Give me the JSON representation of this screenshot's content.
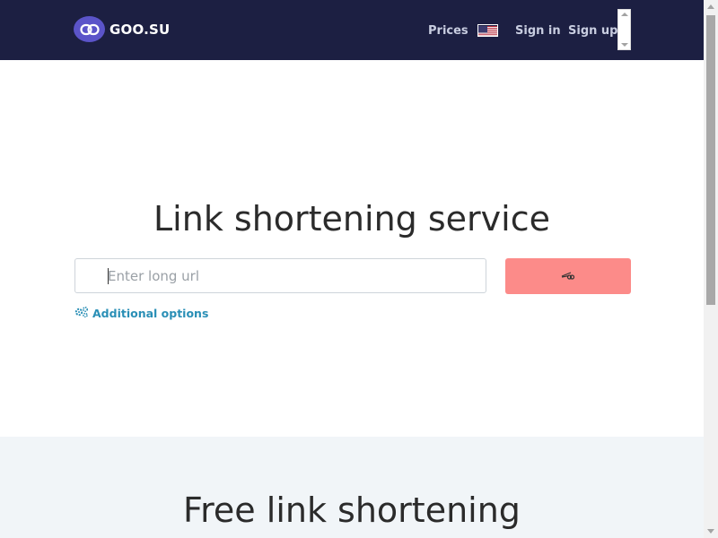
{
  "brand": {
    "name": "GOO.SU",
    "logo_color": "#5b54c9"
  },
  "nav": {
    "prices": "Prices",
    "language_flag": "us-flag-icon",
    "sign_in": "Sign in",
    "sign_up": "Sign up",
    "background_color": "#1c1f42"
  },
  "hero": {
    "title": "Link shortening service",
    "url_input": {
      "placeholder": "Enter long url",
      "value": ""
    },
    "shorten_button": {
      "icon": "scissors-icon",
      "color": "#fc8b89"
    },
    "additional_options": {
      "label": "Additional options",
      "icon": "gears-icon",
      "color": "#2a8fb6"
    }
  },
  "free_section": {
    "title": "Free link shortening",
    "background_color": "#f1f5f8"
  }
}
